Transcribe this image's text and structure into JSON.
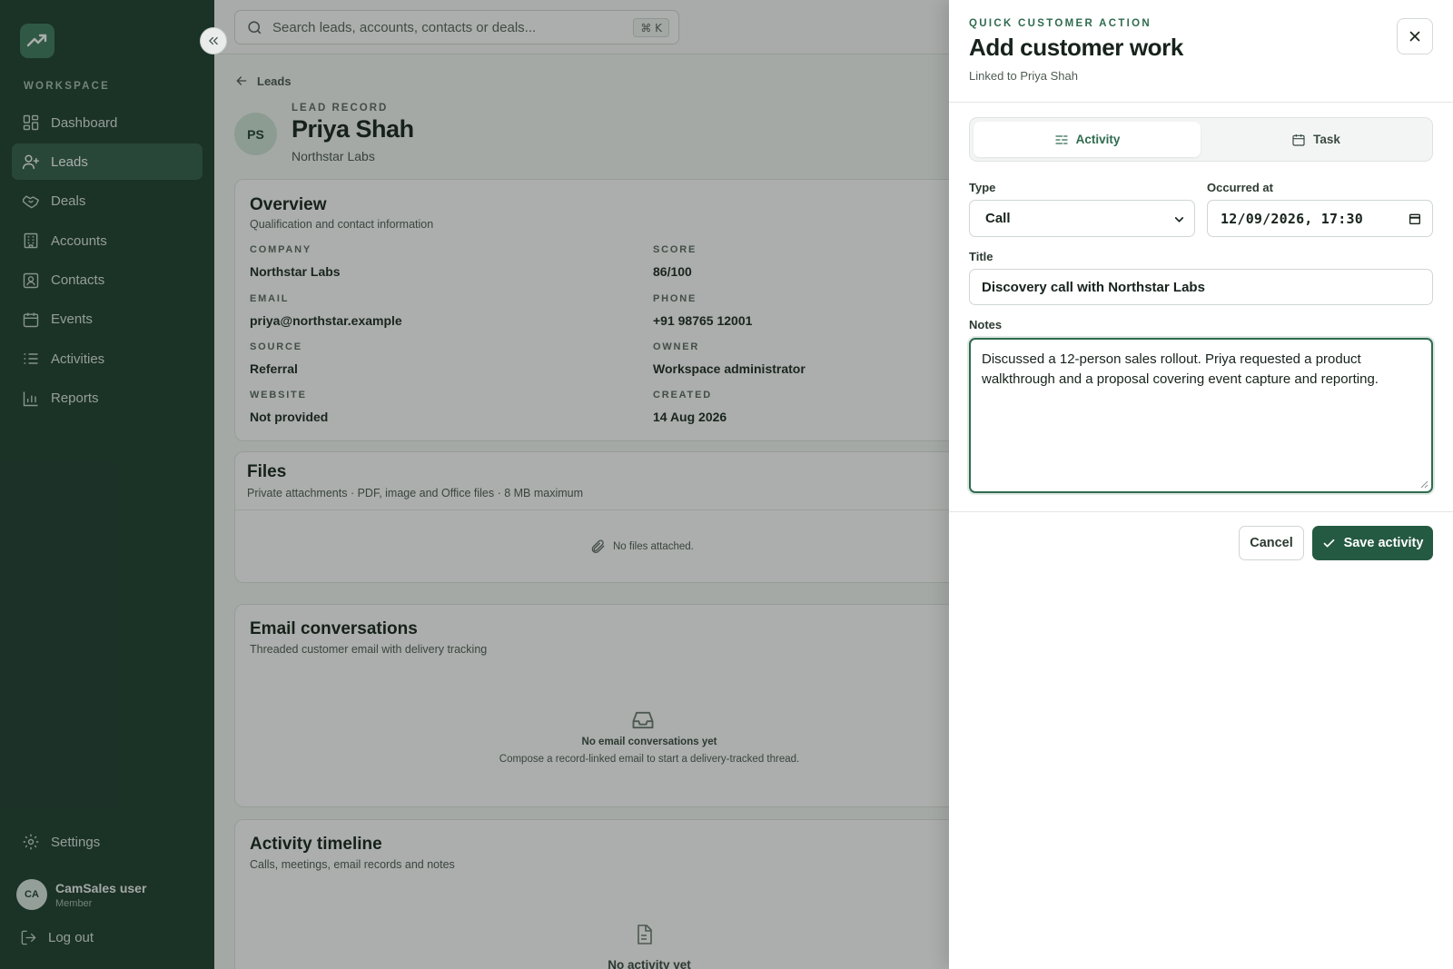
{
  "sidebar": {
    "workspace_label": "WORKSPACE",
    "items": [
      {
        "label": "Dashboard",
        "icon": "dashboard-icon"
      },
      {
        "label": "Leads",
        "icon": "user-plus-icon",
        "active": true
      },
      {
        "label": "Deals",
        "icon": "handshake-icon"
      },
      {
        "label": "Accounts",
        "icon": "building-icon"
      },
      {
        "label": "Contacts",
        "icon": "contact-card-icon"
      },
      {
        "label": "Events",
        "icon": "calendar-icon"
      },
      {
        "label": "Activities",
        "icon": "list-icon"
      },
      {
        "label": "Reports",
        "icon": "bar-chart-icon"
      }
    ],
    "settings_label": "Settings",
    "user": {
      "initials": "CA",
      "name": "CamSales user",
      "role": "Member"
    },
    "logout_label": "Log out"
  },
  "topbar": {
    "search_placeholder": "Search leads, accounts, contacts or deals...",
    "shortcut": "⌘ K"
  },
  "record": {
    "breadcrumb": "Leads",
    "initials": "PS",
    "eyebrow": "LEAD RECORD",
    "name": "Priya Shah",
    "company": "Northstar Labs"
  },
  "overview": {
    "title": "Overview",
    "subtitle": "Qualification and contact information",
    "fields": {
      "company": {
        "label": "COMPANY",
        "value": "Northstar Labs"
      },
      "score": {
        "label": "SCORE",
        "value": "86/100"
      },
      "email": {
        "label": "EMAIL",
        "value": "priya@northstar.example"
      },
      "phone": {
        "label": "PHONE",
        "value": "+91 98765 12001"
      },
      "source": {
        "label": "SOURCE",
        "value": "Referral"
      },
      "owner": {
        "label": "OWNER",
        "value": "Workspace administrator"
      },
      "website": {
        "label": "WEBSITE",
        "value": "Not provided"
      },
      "created": {
        "label": "CREATED",
        "value": "14 Aug 2026"
      }
    }
  },
  "files": {
    "title": "Files",
    "subtitle": "Private attachments · PDF, image and Office files · 8 MB maximum",
    "empty": "No files attached."
  },
  "emails": {
    "title": "Email conversations",
    "subtitle": "Threaded customer email with delivery tracking",
    "empty_title": "No email conversations yet",
    "empty_text": "Compose a record-linked email to start a delivery-tracked thread."
  },
  "timeline": {
    "title": "Activity timeline",
    "subtitle": "Calls, meetings, email records and notes",
    "empty_title": "No activity yet"
  },
  "drawer": {
    "eyebrow": "QUICK CUSTOMER ACTION",
    "title": "Add customer work",
    "linked": "Linked to Priya Shah",
    "tabs": [
      {
        "label": "Activity",
        "active": true
      },
      {
        "label": "Task",
        "active": false
      }
    ],
    "type_label": "Type",
    "type_value": "Call",
    "occurred_label": "Occurred at",
    "occurred_value": "12/09/2026, 17:30",
    "title_label": "Title",
    "title_value": "Discovery call with Northstar Labs",
    "notes_label": "Notes",
    "notes_value": "Discussed a 12-person sales rollout. Priya requested a product walkthrough and a proposal covering event capture and reporting.",
    "cancel_label": "Cancel",
    "save_label": "Save activity"
  },
  "colors": {
    "sidebar_bg": "#1f3d30",
    "active_nav": "#345f4b",
    "accent": "#2f6b4f",
    "primary_button": "#245a42"
  }
}
